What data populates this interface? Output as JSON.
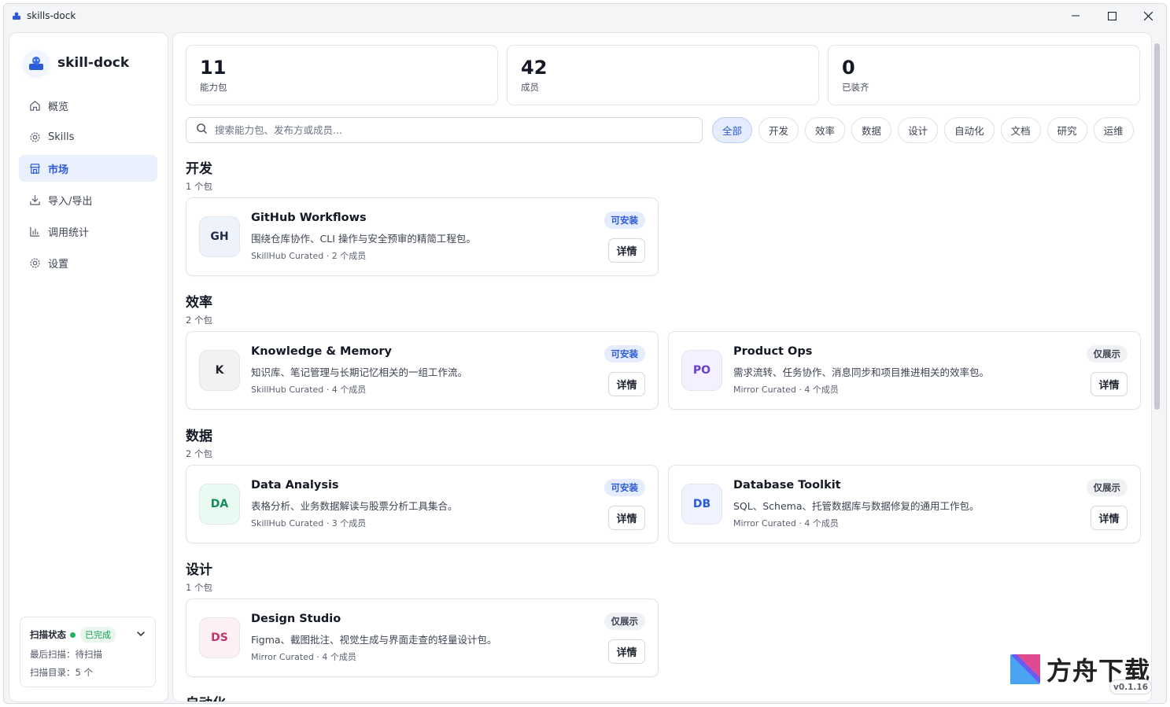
{
  "window": {
    "title": "skills-dock"
  },
  "sidebar": {
    "brand": "skill-dock",
    "items": [
      {
        "label": "概览",
        "icon": "home-icon"
      },
      {
        "label": "Skills",
        "icon": "gear-icon"
      },
      {
        "label": "市场",
        "icon": "store-icon",
        "active": true
      },
      {
        "label": "导入/导出",
        "icon": "download-icon"
      },
      {
        "label": "调用统计",
        "icon": "chart-icon"
      },
      {
        "label": "设置",
        "icon": "settings-icon"
      }
    ],
    "scan": {
      "title": "扫描状态",
      "status": "已完成",
      "last_scan": "最后扫描：待扫描",
      "dirs": "扫描目录：5 个"
    }
  },
  "stats": [
    {
      "value": "11",
      "label": "能力包"
    },
    {
      "value": "42",
      "label": "成员"
    },
    {
      "value": "0",
      "label": "已装齐"
    }
  ],
  "search": {
    "placeholder": "搜索能力包、发布方或成员..."
  },
  "filters": [
    "全部",
    "开发",
    "效率",
    "数据",
    "设计",
    "自动化",
    "文档",
    "研究",
    "运维"
  ],
  "active_filter": "全部",
  "sections": [
    {
      "title": "开发",
      "count": "1 个包"
    },
    {
      "title": "效率",
      "count": "2 个包"
    },
    {
      "title": "数据",
      "count": "2 个包"
    },
    {
      "title": "设计",
      "count": "1 个包"
    },
    {
      "title": "自动化",
      "count": ""
    }
  ],
  "cards": [
    {
      "abbr": "GH",
      "title": "GitHub Workflows",
      "desc": "围绕仓库协作、CLI 操作与安全预审的精简工程包。",
      "meta": "SkillHub Curated · 2 个成员",
      "badge": "可安装",
      "button": "详情",
      "avatar_bg": "#eef2fb",
      "avatar_fg": "#1f2a44"
    },
    {
      "abbr": "K",
      "title": "Knowledge & Memory",
      "desc": "知识库、笔记管理与长期记忆相关的一组工作流。",
      "meta": "SkillHub Curated · 4 个成员",
      "badge": "可安装",
      "button": "详情",
      "avatar_bg": "#f2f2f2",
      "avatar_fg": "#1f2430"
    },
    {
      "abbr": "PO",
      "title": "Product Ops",
      "desc": "需求流转、任务协作、消息同步和项目推进相关的效率包。",
      "meta": "Mirror Curated · 4 个成员",
      "badge": "仅展示",
      "button": "详情",
      "avatar_bg": "#f4f0ff",
      "avatar_fg": "#6a3fd4"
    },
    {
      "abbr": "DA",
      "title": "Data Analysis",
      "desc": "表格分析、业务数据解读与股票分析工具集合。",
      "meta": "SkillHub Curated · 3 个成员",
      "badge": "可安装",
      "button": "详情",
      "avatar_bg": "#e9faf3",
      "avatar_fg": "#178a5e"
    },
    {
      "abbr": "DB",
      "title": "Database Toolkit",
      "desc": "SQL、Schema、托管数据库与数据修复的通用工作包。",
      "meta": "Mirror Curated · 4 个成员",
      "badge": "仅展示",
      "button": "详情",
      "avatar_bg": "#eef3ff",
      "avatar_fg": "#2d5bd7"
    },
    {
      "abbr": "DS",
      "title": "Design Studio",
      "desc": "Figma、截图批注、视觉生成与界面走查的轻量设计包。",
      "meta": "Mirror Curated · 4 个成员",
      "badge": "仅展示",
      "button": "详情",
      "avatar_bg": "#fdf0f5",
      "avatar_fg": "#c2336b"
    }
  ],
  "watermark": {
    "text": "方舟下载"
  },
  "version": "v0.1.16",
  "colors": {
    "accent": "#2d5bd7",
    "accent_bg": "#e4ecfd",
    "success": "#22b35e"
  }
}
